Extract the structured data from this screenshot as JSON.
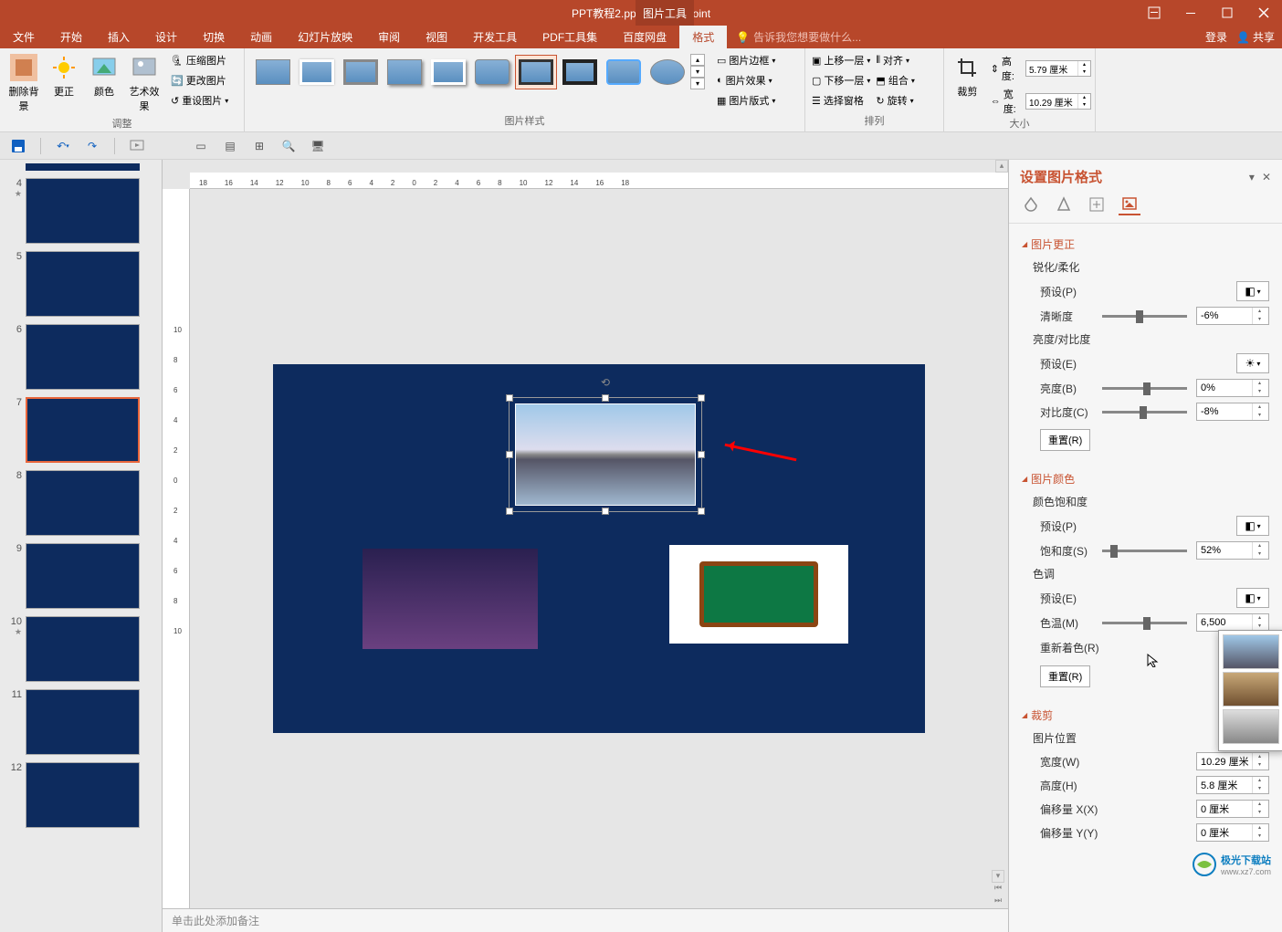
{
  "titlebar": {
    "filename": "PPT教程2.pptx - PowerPoint",
    "contextual_tab": "图片工具"
  },
  "tabs": {
    "file": "文件",
    "home": "开始",
    "insert": "插入",
    "design": "设计",
    "transitions": "切换",
    "animations": "动画",
    "slideshow": "幻灯片放映",
    "review": "审阅",
    "view": "视图",
    "dev": "开发工具",
    "pdf": "PDF工具集",
    "baidu": "百度网盘",
    "format": "格式",
    "tellme": "告诉我您想要做什么...",
    "login": "登录",
    "share": "共享"
  },
  "ribbon": {
    "groups": {
      "adjust": {
        "label": "调整",
        "remove_bg": "删除背景",
        "corrections": "更正",
        "color": "颜色",
        "artistic": "艺术效果",
        "compress": "压缩图片",
        "change": "更改图片",
        "reset": "重设图片"
      },
      "styles": {
        "label": "图片样式",
        "border": "图片边框",
        "effects": "图片效果",
        "layout": "图片版式"
      },
      "arrange": {
        "label": "排列",
        "forward": "上移一层",
        "backward": "下移一层",
        "selection": "选择窗格",
        "align": "对齐",
        "group": "组合",
        "rotate": "旋转"
      },
      "size": {
        "label": "大小",
        "crop": "裁剪",
        "height": "高度:",
        "width": "宽度:",
        "height_val": "5.79 厘米",
        "width_val": "10.29 厘米"
      }
    }
  },
  "ruler_h": [
    "18",
    "16",
    "14",
    "12",
    "10",
    "8",
    "6",
    "4",
    "2",
    "0",
    "2",
    "4",
    "6",
    "8",
    "10",
    "12",
    "14",
    "16",
    "18"
  ],
  "ruler_v": [
    "10",
    "8",
    "6",
    "4",
    "2",
    "0",
    "2",
    "4",
    "6",
    "8",
    "10"
  ],
  "thumbs": [
    {
      "num": "4",
      "star": "★"
    },
    {
      "num": "5"
    },
    {
      "num": "6"
    },
    {
      "num": "7",
      "active": true
    },
    {
      "num": "8"
    },
    {
      "num": "9"
    },
    {
      "num": "10",
      "star": "★"
    },
    {
      "num": "11"
    },
    {
      "num": "12"
    }
  ],
  "notes_placeholder": "单击此处添加备注",
  "pane": {
    "title": "设置图片格式",
    "sections": {
      "correction": {
        "title": "图片更正",
        "sharpen": "锐化/柔化",
        "preset_p": "预设(P)",
        "sharpness": "清晰度",
        "sharpness_val": "-6%",
        "brightness_contrast": "亮度/对比度",
        "preset_e": "预设(E)",
        "brightness": "亮度(B)",
        "brightness_val": "0%",
        "contrast": "对比度(C)",
        "contrast_val": "-8%",
        "reset": "重置(R)"
      },
      "color": {
        "title": "图片颜色",
        "saturation": "颜色饱和度",
        "preset_p": "预设(P)",
        "saturation_s": "饱和度(S)",
        "saturation_val": "52%",
        "tone": "色调",
        "preset_e": "预设(E)",
        "temp": "色温(M)",
        "temp_val": "6,500",
        "recolor": "重新着色(R)",
        "reset": "重置(R)"
      },
      "crop": {
        "title": "裁剪",
        "position": "图片位置",
        "width": "宽度(W)",
        "width_val": "10.29 厘米",
        "height": "高度(H)",
        "height_val": "5.8 厘米",
        "offset_x": "偏移量 X(X)",
        "offset_x_val": "0 厘米",
        "offset_y": "偏移量 Y(Y)",
        "offset_y_val": "0 厘米"
      }
    }
  },
  "watermark": {
    "cn": "极光下载站",
    "url": "www.xz7.com"
  }
}
